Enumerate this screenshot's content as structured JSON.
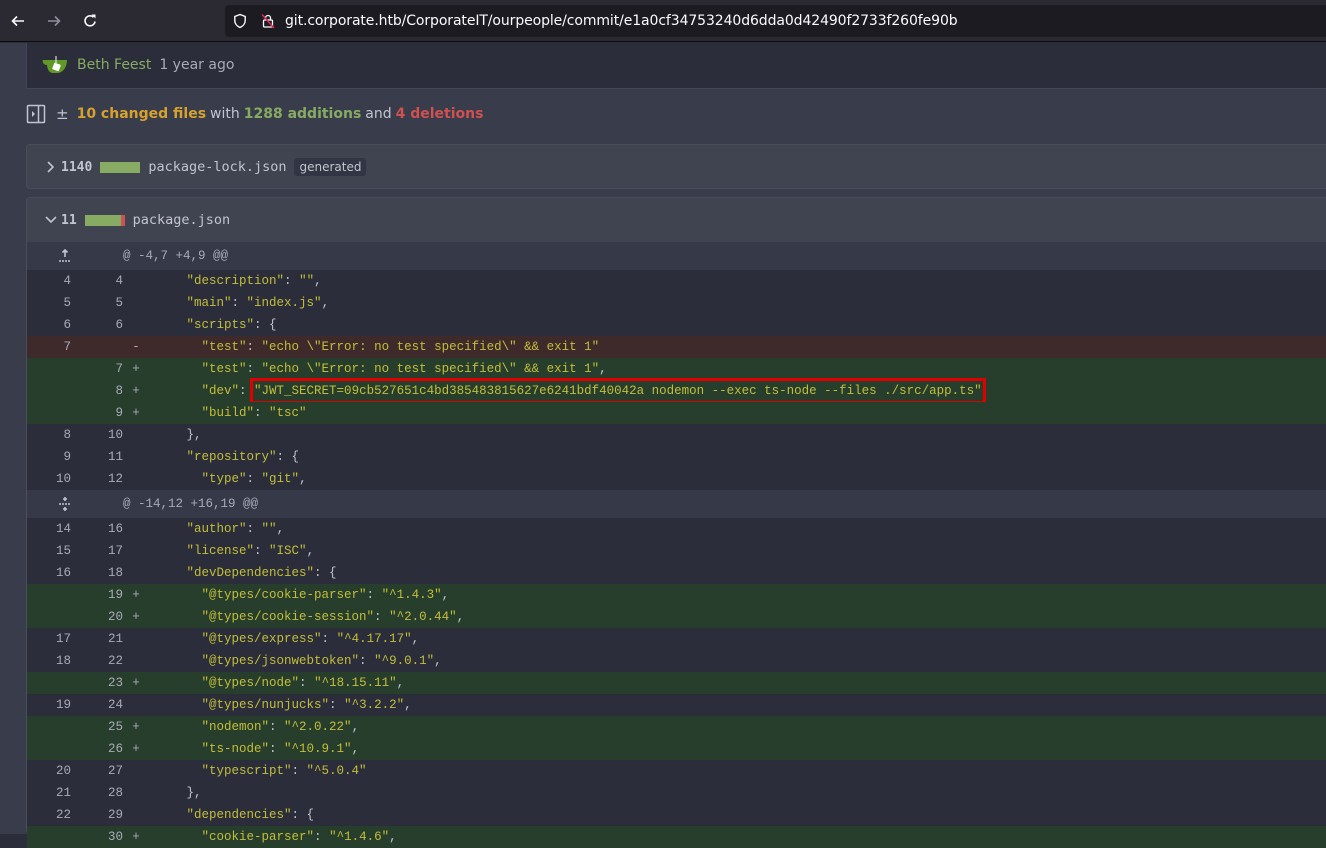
{
  "browser": {
    "url": "git.corporate.htb/CorporateIT/ourpeople/commit/e1a0cf34753240d6dda0d42490f2733f260fe90b",
    "back_icon": "arrow-left-icon",
    "forward_icon": "arrow-right-icon",
    "reload_icon": "reload-icon"
  },
  "commit": {
    "author": "Beth Feest",
    "time_ago": "1 year ago",
    "avatar_icon": "gitea-logo-icon"
  },
  "stats": {
    "files_changed": "10 changed files",
    "with": "with",
    "additions": "1288 additions",
    "and": "and",
    "deletions": "4 deletions",
    "plus_minus": "±"
  },
  "files": [
    {
      "count": "1140",
      "name": "package-lock.json",
      "badge": "generated",
      "expanded": false,
      "add_ratio": 1.0
    },
    {
      "count": "11",
      "name": "package.json",
      "expanded": true,
      "add_ratio": 0.9,
      "hunks": [
        {
          "header": "@ -4,7 +4,9 @@",
          "expand_icon": "expand-up-icon",
          "lines": [
            {
              "type": "ctx",
              "old": "4",
              "new": "4",
              "sign": "",
              "indent": "  ",
              "key": "\"description\"",
              "sep": ": ",
              "val": "\"\"",
              "tail": ","
            },
            {
              "type": "ctx",
              "old": "5",
              "new": "5",
              "sign": "",
              "indent": "  ",
              "key": "\"main\"",
              "sep": ": ",
              "val": "\"index.js\"",
              "tail": ","
            },
            {
              "type": "ctx",
              "old": "6",
              "new": "6",
              "sign": "",
              "indent": "  ",
              "key": "\"scripts\"",
              "sep": ": {",
              "val": "",
              "tail": ""
            },
            {
              "type": "del",
              "old": "7",
              "new": "",
              "sign": "-",
              "indent": "    ",
              "key": "\"test\"",
              "sep": ": ",
              "val": "\"echo \\\"Error: no test specified\\\" && exit 1\"",
              "tail": ""
            },
            {
              "type": "add",
              "old": "",
              "new": "7",
              "sign": "+",
              "indent": "    ",
              "key": "\"test\"",
              "sep": ": ",
              "val": "\"echo \\\"Error: no test specified\\\" && exit 1\"",
              "tail": ","
            },
            {
              "type": "add",
              "old": "",
              "new": "8",
              "sign": "+",
              "indent": "    ",
              "key": "\"dev\"",
              "sep": ": ",
              "val": "\"JWT_SECRET=09cb527651c4bd385483815627e6241bdf40042a nodemon --exec ts-node --files ./src/app.ts\"",
              "tail": ",",
              "highlighted": true
            },
            {
              "type": "add",
              "old": "",
              "new": "9",
              "sign": "+",
              "indent": "    ",
              "key": "\"build\"",
              "sep": ": ",
              "val": "\"tsc\"",
              "tail": ""
            },
            {
              "type": "ctx",
              "old": "8",
              "new": "10",
              "sign": "",
              "indent": "  ",
              "key": "",
              "sep": "},",
              "val": "",
              "tail": ""
            },
            {
              "type": "ctx",
              "old": "9",
              "new": "11",
              "sign": "",
              "indent": "  ",
              "key": "\"repository\"",
              "sep": ": {",
              "val": "",
              "tail": ""
            },
            {
              "type": "ctx",
              "old": "10",
              "new": "12",
              "sign": "",
              "indent": "    ",
              "key": "\"type\"",
              "sep": ": ",
              "val": "\"git\"",
              "tail": ","
            }
          ]
        },
        {
          "header": "@ -14,12 +16,19 @@",
          "expand_icon": "expand-both-icon",
          "lines": [
            {
              "type": "ctx",
              "old": "14",
              "new": "16",
              "sign": "",
              "indent": "  ",
              "key": "\"author\"",
              "sep": ": ",
              "val": "\"\"",
              "tail": ","
            },
            {
              "type": "ctx",
              "old": "15",
              "new": "17",
              "sign": "",
              "indent": "  ",
              "key": "\"license\"",
              "sep": ": ",
              "val": "\"ISC\"",
              "tail": ","
            },
            {
              "type": "ctx",
              "old": "16",
              "new": "18",
              "sign": "",
              "indent": "  ",
              "key": "\"devDependencies\"",
              "sep": ": {",
              "val": "",
              "tail": ""
            },
            {
              "type": "add",
              "old": "",
              "new": "19",
              "sign": "+",
              "indent": "    ",
              "key": "\"@types/cookie-parser\"",
              "sep": ": ",
              "val": "\"^1.4.3\"",
              "tail": ","
            },
            {
              "type": "add",
              "old": "",
              "new": "20",
              "sign": "+",
              "indent": "    ",
              "key": "\"@types/cookie-session\"",
              "sep": ": ",
              "val": "\"^2.0.44\"",
              "tail": ","
            },
            {
              "type": "ctx",
              "old": "17",
              "new": "21",
              "sign": "",
              "indent": "    ",
              "key": "\"@types/express\"",
              "sep": ": ",
              "val": "\"^4.17.17\"",
              "tail": ","
            },
            {
              "type": "ctx",
              "old": "18",
              "new": "22",
              "sign": "",
              "indent": "    ",
              "key": "\"@types/jsonwebtoken\"",
              "sep": ": ",
              "val": "\"^9.0.1\"",
              "tail": ","
            },
            {
              "type": "add",
              "old": "",
              "new": "23",
              "sign": "+",
              "indent": "    ",
              "key": "\"@types/node\"",
              "sep": ": ",
              "val": "\"^18.15.11\"",
              "tail": ","
            },
            {
              "type": "ctx",
              "old": "19",
              "new": "24",
              "sign": "",
              "indent": "    ",
              "key": "\"@types/nunjucks\"",
              "sep": ": ",
              "val": "\"^3.2.2\"",
              "tail": ","
            },
            {
              "type": "add",
              "old": "",
              "new": "25",
              "sign": "+",
              "indent": "    ",
              "key": "\"nodemon\"",
              "sep": ": ",
              "val": "\"^2.0.22\"",
              "tail": ","
            },
            {
              "type": "add",
              "old": "",
              "new": "26",
              "sign": "+",
              "indent": "    ",
              "key": "\"ts-node\"",
              "sep": ": ",
              "val": "\"^10.9.1\"",
              "tail": ","
            },
            {
              "type": "ctx",
              "old": "20",
              "new": "27",
              "sign": "",
              "indent": "    ",
              "key": "\"typescript\"",
              "sep": ": ",
              "val": "\"^5.0.4\"",
              "tail": ""
            },
            {
              "type": "ctx",
              "old": "21",
              "new": "28",
              "sign": "",
              "indent": "  ",
              "key": "",
              "sep": "},",
              "val": "",
              "tail": ""
            },
            {
              "type": "ctx",
              "old": "22",
              "new": "29",
              "sign": "",
              "indent": "  ",
              "key": "\"dependencies\"",
              "sep": ": {",
              "val": "",
              "tail": ""
            },
            {
              "type": "add",
              "old": "",
              "new": "30",
              "sign": "+",
              "indent": "    ",
              "key": "\"cookie-parser\"",
              "sep": ": ",
              "val": "\"^1.4.6\"",
              "tail": ","
            }
          ]
        }
      ]
    }
  ],
  "colors": {
    "accent_add": "#87ab63",
    "accent_del": "#d05151",
    "files_changed": "#d6a22f",
    "json_string": "#c3be3a",
    "highlight_box": "#e00000"
  }
}
